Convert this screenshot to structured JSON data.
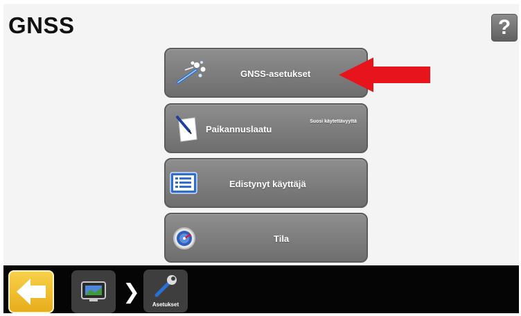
{
  "header": {
    "title": "GNSS",
    "help_label": "?"
  },
  "menu": {
    "items": [
      {
        "label": "GNSS-asetukset",
        "icon": "satellite-icon"
      },
      {
        "label": "Paikannuslaatu",
        "note": "Suosi käytettävyyttä",
        "icon": "document-pen-icon"
      },
      {
        "label": "Edistynyt käyttäjä",
        "icon": "list-settings-icon"
      },
      {
        "label": "Tila",
        "icon": "gauge-icon"
      }
    ]
  },
  "annotation": {
    "arrow_color": "#e8141c",
    "points_to": "GNSS-asetukset"
  },
  "navbar": {
    "back_icon": "back-arrow-icon",
    "home_icon": "display-icon",
    "separator_icon": "chevron-right-icon",
    "breadcrumb_label": "Asetukset",
    "breadcrumb_icon": "wrench-icon"
  },
  "colors": {
    "button_gray": "#7d7d7d",
    "back_button_yellow": "#f1bd2c",
    "bottom_bar": "#050505",
    "arrow_red": "#e8141c"
  }
}
